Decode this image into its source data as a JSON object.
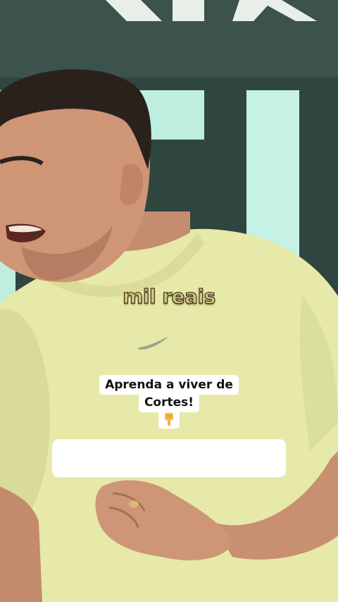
{
  "video": {
    "subtitle": "mil reais"
  },
  "sticker": {
    "line1": "Aprenda a viver de",
    "line2": "Cortes!",
    "emoji_icon": "pointing-down-hand-icon"
  },
  "colors": {
    "background": "#2f4540",
    "shirt": "#e6e9a8",
    "subtitle_text": "#d8c77a",
    "sticker_bg": "#ffffff"
  }
}
